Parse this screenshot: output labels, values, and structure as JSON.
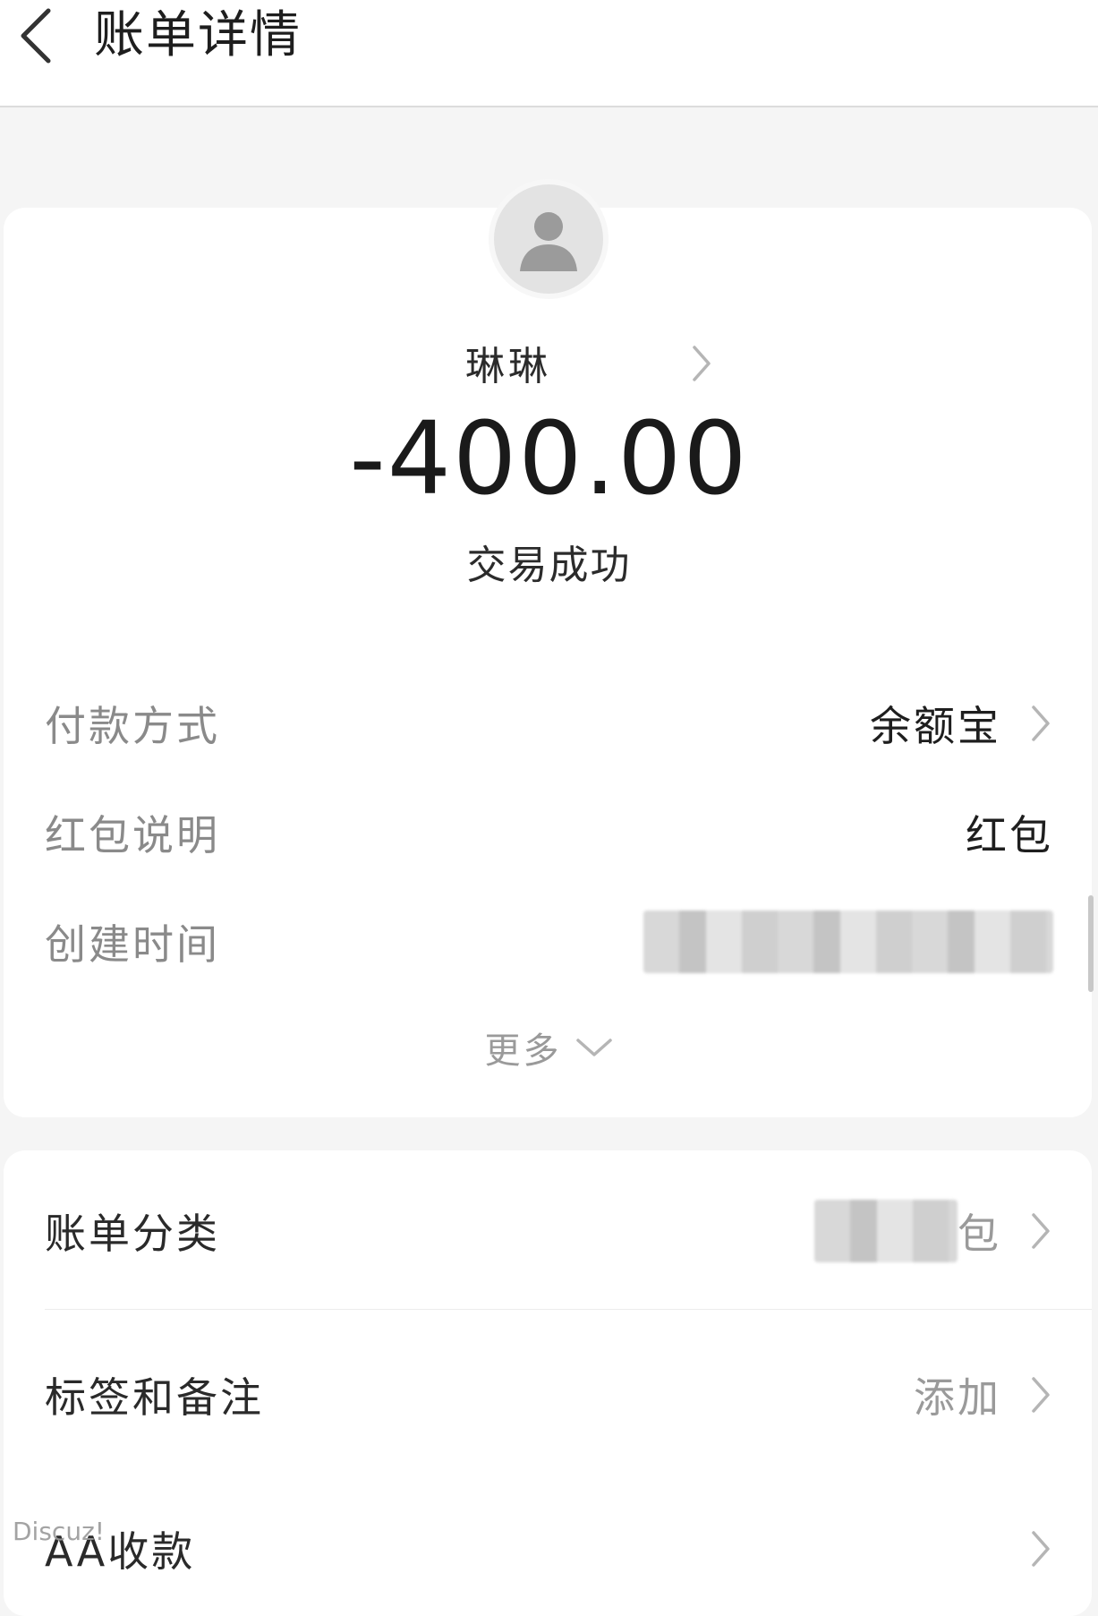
{
  "header": {
    "title": "账单详情"
  },
  "payee": {
    "name": "琳琳"
  },
  "transaction": {
    "amount": "-400.00",
    "status": "交易成功"
  },
  "details": [
    {
      "label": "付款方式",
      "value": "余额宝"
    },
    {
      "label": "红包说明",
      "value": "红包"
    },
    {
      "label": "创建时间",
      "value": ""
    }
  ],
  "more": {
    "label": "更多"
  },
  "actions": [
    {
      "label": "账单分类",
      "value": "包"
    },
    {
      "label": "标签和备注",
      "value": "添加"
    },
    {
      "label": "AA收款",
      "value": ""
    }
  ],
  "watermark": "Discuz!",
  "icons": {
    "back": "back-arrow-icon",
    "chevron": "chevron-right-icon",
    "avatar": "user-avatar-icon",
    "expand": "chevron-down-icon"
  }
}
